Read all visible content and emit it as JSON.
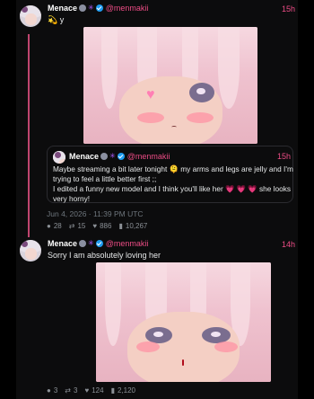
{
  "post1": {
    "display_name": "Menace",
    "handle": "@menmakii",
    "time": "15h",
    "text_emoji": "💫",
    "text": "y",
    "timestamp": "Jun 4, 2026 · 11:39 PM UTC",
    "stats": {
      "replies": "28",
      "retweets": "15",
      "likes": "886",
      "views": "10,267"
    }
  },
  "quote": {
    "display_name": "Menace",
    "handle": "@menmakii",
    "time": "15h",
    "line1": "Maybe streaming a bit later tonight 🫠 my arms and legs are jelly and I'm",
    "line2": "trying to feel a little better first ;;",
    "line3": "I edited a funny new model and I think you'll like her 💗 💗 💗 she looks",
    "line4": "very horny!"
  },
  "post2": {
    "display_name": "Menace",
    "handle": "@menmakii",
    "time": "14h",
    "text": "Sorry I am absolutely loving her",
    "stats": {
      "replies": "3",
      "retweets": "3",
      "likes": "124",
      "views": "2,120"
    }
  },
  "colors": {
    "accent": "#ec4c85",
    "verified": "#1d9bf0",
    "thread_line": "#c0456f"
  },
  "icons": [
    "reply-icon",
    "retweet-icon",
    "like-icon",
    "views-icon",
    "verified-icon"
  ]
}
